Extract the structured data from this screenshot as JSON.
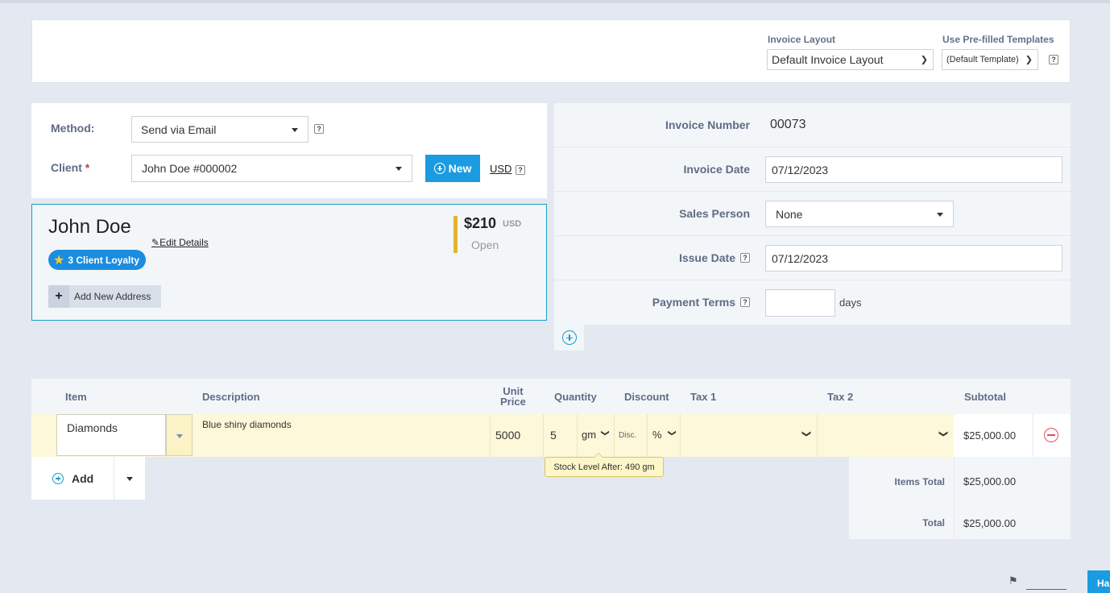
{
  "layout_bar": {
    "invoice_layout_label": "Invoice Layout",
    "invoice_layout_value": "Default Invoice Layout",
    "templates_label": "Use Pre-filled Templates",
    "templates_value": "(Default Template)",
    "help": "?"
  },
  "client_form": {
    "method_label": "Method:",
    "method_value": "Send via Email",
    "client_label": "Client",
    "required_mark": "*",
    "client_value": "John Doe #000002",
    "new_button": "New",
    "currency": "USD",
    "help": "?"
  },
  "client_card": {
    "name": "John Doe",
    "edit_link": "Edit Details",
    "loyalty_badge": "3 Client Loyalty",
    "add_address": "Add New Address",
    "balance": "$210",
    "balance_currency": "USD",
    "balance_status": "Open"
  },
  "invoice_info": {
    "number_label": "Invoice Number",
    "number_value": "00073",
    "date_label": "Invoice Date",
    "date_value": "07/12/2023",
    "sales_label": "Sales Person",
    "sales_value": "None",
    "issue_label": "Issue Date",
    "issue_value": "07/12/2023",
    "terms_label": "Payment Terms",
    "terms_value": "",
    "terms_unit": "days",
    "help": "?"
  },
  "items_table": {
    "headers": {
      "item": "Item",
      "description": "Description",
      "unit_price_1": "Unit",
      "unit_price_2": "Price",
      "quantity": "Quantity",
      "discount": "Discount",
      "tax1": "Tax 1",
      "tax2": "Tax 2",
      "subtotal": "Subtotal"
    },
    "row": {
      "item": "Diamonds",
      "description": "Blue shiny diamonds",
      "unit_price": "5000",
      "quantity": "5",
      "unit": "gm",
      "discount_placeholder": "Disc.",
      "discount_type": "%",
      "tax1": "",
      "tax2": "",
      "subtotal": "$25,000.00"
    },
    "stock_tooltip": "Stock Level After: 490 gm",
    "add_button": "Add"
  },
  "totals": {
    "items_total_label": "Items Total",
    "items_total_value": "$25,000.00",
    "total_label": "Total",
    "total_value": "$25,000.00"
  },
  "footer": {
    "help_button": "Ha"
  },
  "colors": {
    "accent": "#1b9be0",
    "row_highlight": "#fdf8d9",
    "balance_bar": "#e4b42f",
    "remove": "#e0505a"
  }
}
